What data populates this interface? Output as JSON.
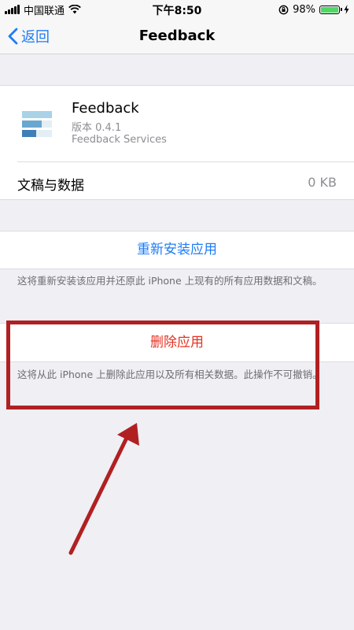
{
  "status_bar": {
    "carrier": "中国联通",
    "time": "下午8:50",
    "battery_percent": "98%",
    "battery_level": 0.98,
    "icons": [
      "signal-icon",
      "wifi-icon",
      "orientation-lock-icon",
      "battery-icon",
      "charging-icon"
    ]
  },
  "nav": {
    "back_label": "返回",
    "title": "Feedback"
  },
  "app": {
    "name": "Feedback",
    "version": "版本 0.4.1",
    "vendor": "Feedback Services",
    "data_label": "文稿与数据",
    "data_value": "0 KB"
  },
  "actions": {
    "reinstall_label": "重新安装应用",
    "reinstall_note": "这将重新安装该应用并还原此 iPhone 上现有的所有应用数据和文稿。",
    "delete_label": "删除应用",
    "delete_note": "这将从此 iPhone 上删除此应用以及所有相关数据。此操作不可撤销。"
  },
  "colors": {
    "accent_blue": "#1f7cf5",
    "destructive_red": "#e53224",
    "annotation_red": "#b02022",
    "background": "#efeff4"
  }
}
